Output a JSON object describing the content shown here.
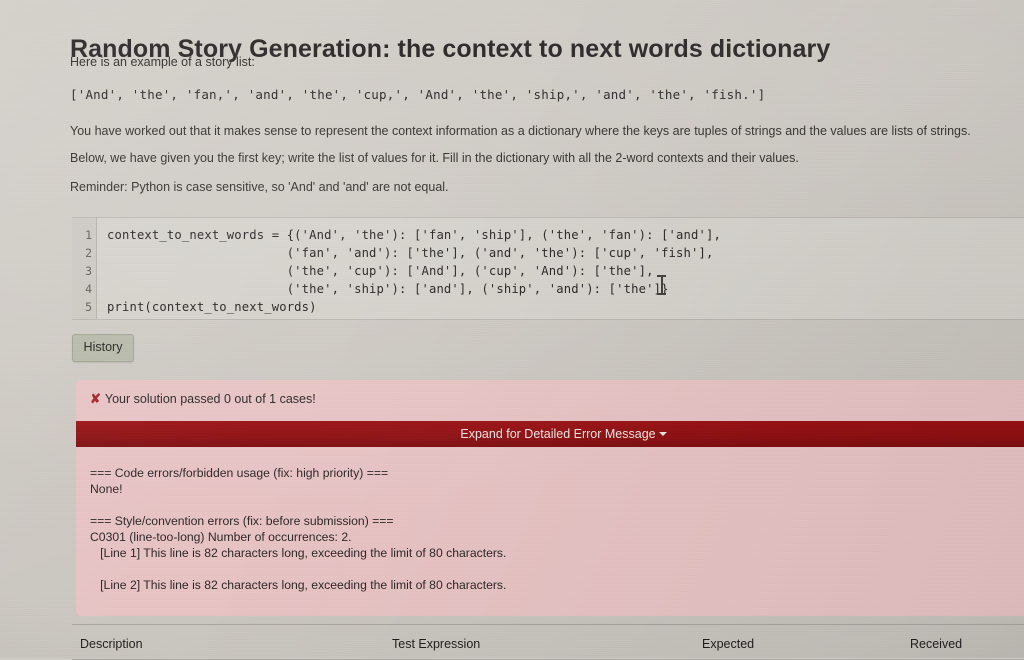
{
  "header": {
    "title": "Random Story Generation: the context to next words dictionary",
    "intro": "Here is an example of a story list:",
    "story_list": "['And', 'the', 'fan,', 'and', 'the', 'cup,', 'And', 'the', 'ship,', 'and', 'the', 'fish.']"
  },
  "instructions": {
    "p1": "You have worked out that it makes sense to represent the context information as a dictionary where the keys are tuples of strings and the values are lists of strings.",
    "p2": "Below, we have given you the first key; write the list of values for it. Fill in the dictionary with all the 2-word contexts and their values.",
    "p3": "Reminder: Python is case sensitive, so 'And' and 'and' are not equal."
  },
  "editor": {
    "line_numbers": [
      "1",
      "2",
      "3",
      "4",
      "5"
    ],
    "lines": [
      "context_to_next_words = {('And', 'the'): ['fan', 'ship'], ('the', 'fan'): ['and'],",
      "                        ('fan', 'and'): ['the'], ('and', 'the'): ['cup', 'fish'],",
      "                        ('the', 'cup'): ['And'], ('cup', 'And'): ['the'],",
      "                        ('the', 'ship'): ['and'], ('ship', 'and'): ['the']}",
      "print(context_to_next_words)"
    ]
  },
  "toolbar": {
    "history_label": "History"
  },
  "alert": {
    "status_icon": "x-mark",
    "status_text": "Your solution passed 0 out of 1 cases!",
    "expand_label": "Expand for Detailed Error Message",
    "expand_caret": "chevron-down-icon",
    "error_lines": [
      "=== Code errors/forbidden usage (fix: high priority) ===",
      "None!",
      "",
      "=== Style/convention errors (fix: before submission) ===",
      "C0301 (line-too-long) Number of occurrences: 2.",
      "   [Line 1] This line is 82 characters long, exceeding the limit of 80 characters.",
      "",
      "   [Line 2] This line is 82 characters long, exceeding the limit of 80 characters."
    ]
  },
  "results_table": {
    "columns": [
      "Description",
      "Test Expression",
      "Expected",
      "Received"
    ]
  },
  "colors": {
    "page_bg": "#cdc9c3",
    "editor_bg": "#d4d1cb",
    "alert_bg": "#e8c3c4",
    "expand_bar": "#8e0f11",
    "error_accent": "#a4212a",
    "history_btn": "#b6b8a8"
  }
}
